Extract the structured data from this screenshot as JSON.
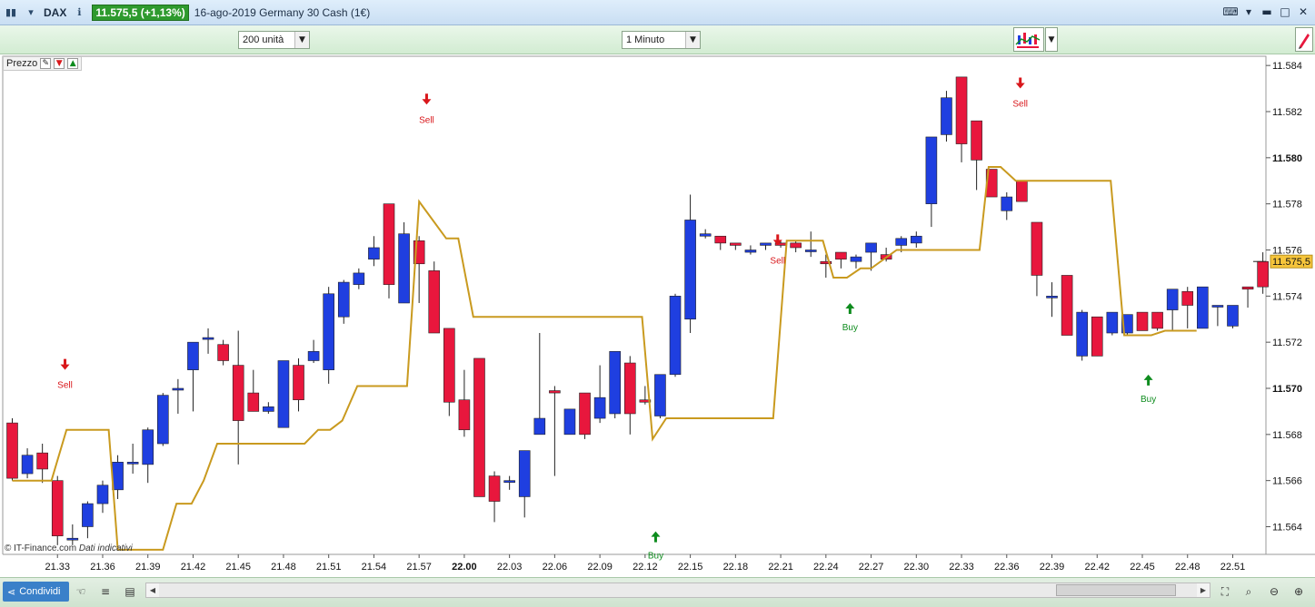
{
  "titlebar": {
    "ticker": "DAX",
    "price_badge": "11.575,5 (+1,13%)",
    "description": "16-ago-2019 Germany 30 Cash (1€)"
  },
  "toolbar": {
    "units_select": "200 unità",
    "interval_select": "1 Minuto"
  },
  "panel": {
    "label": "Prezzo"
  },
  "footer": {
    "copyright": "© IT-Finance.com",
    "note": "Dati indicativi"
  },
  "statusbar": {
    "share_label": "Condividi"
  },
  "colors": {
    "up": "#1f3fe0",
    "down": "#e8173d",
    "line": "#c99a1f",
    "sell": "#d9171b",
    "buy": "#0e8c1e",
    "last_price_bg": "#f6c53b"
  },
  "chart_data": {
    "type": "candlestick",
    "ylim": [
      11562.8,
      11584.4
    ],
    "y_ticks": [
      {
        "value": 11584,
        "label": "11.584"
      },
      {
        "value": 11582,
        "label": "11.582"
      },
      {
        "value": 11580,
        "label": "11.580",
        "bold": true
      },
      {
        "value": 11578,
        "label": "11.578"
      },
      {
        "value": 11576,
        "label": "11.576"
      },
      {
        "value": 11574,
        "label": "11.574"
      },
      {
        "value": 11572,
        "label": "11.572"
      },
      {
        "value": 11570,
        "label": "11.570",
        "bold": true
      },
      {
        "value": 11568,
        "label": "11.568"
      },
      {
        "value": 11566,
        "label": "11.566"
      },
      {
        "value": 11564,
        "label": "11.564"
      }
    ],
    "x_ticks": [
      {
        "index": 3,
        "label": "21.33"
      },
      {
        "index": 6,
        "label": "21.36"
      },
      {
        "index": 9,
        "label": "21.39"
      },
      {
        "index": 12,
        "label": "21.42"
      },
      {
        "index": 15,
        "label": "21.45"
      },
      {
        "index": 18,
        "label": "21.48"
      },
      {
        "index": 21,
        "label": "21.51"
      },
      {
        "index": 24,
        "label": "21.54"
      },
      {
        "index": 27,
        "label": "21.57"
      },
      {
        "index": 30,
        "label": "22.00",
        "bold": true
      },
      {
        "index": 33,
        "label": "22.03"
      },
      {
        "index": 36,
        "label": "22.06"
      },
      {
        "index": 39,
        "label": "22.09"
      },
      {
        "index": 42,
        "label": "22.12"
      },
      {
        "index": 45,
        "label": "22.15"
      },
      {
        "index": 48,
        "label": "22.18"
      },
      {
        "index": 51,
        "label": "22.21"
      },
      {
        "index": 54,
        "label": "22.24"
      },
      {
        "index": 57,
        "label": "22.27"
      },
      {
        "index": 60,
        "label": "22.30"
      },
      {
        "index": 63,
        "label": "22.33"
      },
      {
        "index": 66,
        "label": "22.36"
      },
      {
        "index": 69,
        "label": "22.39"
      },
      {
        "index": 72,
        "label": "22.42"
      },
      {
        "index": 75,
        "label": "22.45"
      },
      {
        "index": 78,
        "label": "22.48"
      },
      {
        "index": 81,
        "label": "22.51"
      }
    ],
    "last_price": {
      "value": 11575.5,
      "label": "11.575,5"
    },
    "candles": [
      [
        11568.5,
        11568.7,
        11566.0,
        11566.1
      ],
      [
        11566.3,
        11567.4,
        11566.1,
        11567.1
      ],
      [
        11567.2,
        11567.6,
        11565.9,
        11566.5
      ],
      [
        11566.0,
        11566.2,
        11563.2,
        11563.6
      ],
      [
        11563.5,
        11564.1,
        11563.2,
        11563.5
      ],
      [
        11564.0,
        11565.1,
        11563.5,
        11565.0
      ],
      [
        11565.0,
        11566.0,
        11564.6,
        11565.8
      ],
      [
        11565.6,
        11567.1,
        11565.2,
        11566.8
      ],
      [
        11566.8,
        11567.6,
        11566.3,
        11566.8
      ],
      [
        11566.7,
        11568.3,
        11565.9,
        11568.2
      ],
      [
        11567.6,
        11569.8,
        11567.5,
        11569.7
      ],
      [
        11570.0,
        11570.4,
        11568.9,
        11570.0
      ],
      [
        11570.8,
        11572.0,
        11569.0,
        11572.0
      ],
      [
        11572.2,
        11572.6,
        11571.5,
        11572.2
      ],
      [
        11571.9,
        11572.1,
        11571.0,
        11571.2
      ],
      [
        11571.0,
        11572.5,
        11566.7,
        11568.6
      ],
      [
        11569.8,
        11570.8,
        11569.0,
        11569.0
      ],
      [
        11569.0,
        11569.4,
        11568.9,
        11569.2
      ],
      [
        11568.3,
        11571.2,
        11568.3,
        11571.2
      ],
      [
        11571.0,
        11571.3,
        11569.0,
        11569.5
      ],
      [
        11571.2,
        11572.1,
        11571.1,
        11571.6
      ],
      [
        11570.8,
        11574.4,
        11570.2,
        11574.1
      ],
      [
        11573.1,
        11574.7,
        11572.8,
        11574.6
      ],
      [
        11574.5,
        11575.2,
        11574.3,
        11575.0
      ],
      [
        11575.6,
        11576.6,
        11575.3,
        11576.1
      ],
      [
        11578.0,
        11578.0,
        11573.9,
        11574.5
      ],
      [
        11573.7,
        11577.2,
        11573.7,
        11576.7
      ],
      [
        11576.4,
        11576.6,
        11573.7,
        11575.4
      ],
      [
        11575.1,
        11575.5,
        11572.4,
        11572.4
      ],
      [
        11572.6,
        11572.6,
        11568.8,
        11569.4
      ],
      [
        11569.5,
        11570.8,
        11567.9,
        11568.2
      ],
      [
        11571.3,
        11571.3,
        11565.3,
        11565.3
      ],
      [
        11566.2,
        11566.4,
        11564.2,
        11565.1
      ],
      [
        11566.0,
        11566.2,
        11565.6,
        11566.0
      ],
      [
        11565.3,
        11567.3,
        11564.4,
        11567.3
      ],
      [
        11568.0,
        11572.4,
        11568.0,
        11568.7
      ],
      [
        11569.9,
        11570.1,
        11566.2,
        11569.8
      ],
      [
        11568.0,
        11569.1,
        11568.0,
        11569.1
      ],
      [
        11569.8,
        11569.8,
        11567.8,
        11568.0
      ],
      [
        11568.7,
        11571.0,
        11568.5,
        11569.6
      ],
      [
        11568.9,
        11571.6,
        11568.7,
        11571.6
      ],
      [
        11571.1,
        11571.4,
        11568.0,
        11568.9
      ],
      [
        11569.5,
        11570.1,
        11569.3,
        11569.4
      ],
      [
        11568.8,
        11570.6,
        11568.7,
        11570.6
      ],
      [
        11570.6,
        11574.1,
        11570.5,
        11574.0
      ],
      [
        11573.0,
        11578.4,
        11572.4,
        11577.3
      ],
      [
        11576.6,
        11576.9,
        11576.5,
        11576.7
      ],
      [
        11576.6,
        11576.6,
        11576.0,
        11576.3
      ],
      [
        11576.3,
        11576.3,
        11576.0,
        11576.2
      ],
      [
        11575.9,
        11576.2,
        11575.8,
        11576.0
      ],
      [
        11576.2,
        11576.3,
        11576.0,
        11576.3
      ],
      [
        11576.3,
        11576.4,
        11576.1,
        11576.2
      ],
      [
        11576.3,
        11576.4,
        11575.9,
        11576.1
      ],
      [
        11576.0,
        11576.8,
        11575.7,
        11576.0
      ],
      [
        11575.5,
        11575.8,
        11574.8,
        11575.4
      ],
      [
        11575.9,
        11575.9,
        11575.2,
        11575.6
      ],
      [
        11575.5,
        11575.8,
        11575.2,
        11575.7
      ],
      [
        11575.9,
        11576.3,
        11575.1,
        11576.3
      ],
      [
        11575.8,
        11576.1,
        11575.5,
        11575.6
      ],
      [
        11576.2,
        11576.6,
        11575.9,
        11576.5
      ],
      [
        11576.3,
        11576.8,
        11576.1,
        11576.6
      ],
      [
        11578.0,
        11579.4,
        11577.0,
        11580.9
      ],
      [
        11581.0,
        11582.9,
        11580.7,
        11582.6
      ],
      [
        11583.5,
        11583.5,
        11579.8,
        11580.6
      ],
      [
        11581.6,
        11581.6,
        11578.6,
        11579.9
      ],
      [
        11579.5,
        11579.5,
        11578.4,
        11578.3
      ],
      [
        11577.7,
        11578.5,
        11577.3,
        11578.3
      ],
      [
        11579.0,
        11579.0,
        11578.1,
        11578.1
      ],
      [
        11577.2,
        11577.2,
        11574.0,
        11574.9
      ],
      [
        11574.0,
        11574.6,
        11573.1,
        11574.0
      ],
      [
        11574.9,
        11574.9,
        11572.3,
        11572.3
      ],
      [
        11571.4,
        11573.4,
        11571.2,
        11573.3
      ],
      [
        11573.1,
        11573.1,
        11571.4,
        11571.4
      ],
      [
        11572.4,
        11573.3,
        11572.3,
        11573.3
      ],
      [
        11572.4,
        11573.2,
        11572.3,
        11573.2
      ],
      [
        11573.3,
        11573.3,
        11572.5,
        11572.5
      ],
      [
        11573.3,
        11573.3,
        11572.5,
        11572.6
      ],
      [
        11573.4,
        11574.3,
        11572.5,
        11574.3
      ],
      [
        11574.2,
        11574.4,
        11572.6,
        11573.6
      ],
      [
        11572.6,
        11574.4,
        11572.6,
        11574.4
      ],
      [
        11573.6,
        11573.6,
        11572.7,
        11573.6
      ],
      [
        11572.7,
        11573.6,
        11572.6,
        11573.6
      ],
      [
        11574.4,
        11574.4,
        11573.5,
        11574.3
      ],
      [
        11575.5,
        11575.9,
        11574.1,
        11574.4
      ]
    ],
    "line": [
      [
        0,
        11566.0
      ],
      [
        2.6,
        11566.0
      ],
      [
        3.6,
        11568.2
      ],
      [
        6.4,
        11568.2
      ],
      [
        7.0,
        11563.0
      ],
      [
        10.0,
        11563.0
      ],
      [
        10.9,
        11565.0
      ],
      [
        11.9,
        11565.0
      ],
      [
        12.7,
        11566.0
      ],
      [
        13.6,
        11567.6
      ],
      [
        19.4,
        11567.6
      ],
      [
        20.3,
        11568.2
      ],
      [
        21.1,
        11568.2
      ],
      [
        21.9,
        11568.6
      ],
      [
        22.9,
        11570.1
      ],
      [
        26.2,
        11570.1
      ],
      [
        27.0,
        11578.1
      ],
      [
        28.8,
        11576.5
      ],
      [
        29.6,
        11576.5
      ],
      [
        30.6,
        11573.1
      ],
      [
        41.8,
        11573.1
      ],
      [
        42.5,
        11567.8
      ],
      [
        43.4,
        11568.7
      ],
      [
        50.5,
        11568.7
      ],
      [
        51.4,
        11576.4
      ],
      [
        53.8,
        11576.4
      ],
      [
        54.5,
        11574.8
      ],
      [
        55.4,
        11574.8
      ],
      [
        56.3,
        11575.2
      ],
      [
        57.0,
        11575.2
      ],
      [
        58.7,
        11576.0
      ],
      [
        64.2,
        11576.0
      ],
      [
        64.8,
        11579.6
      ],
      [
        65.6,
        11579.6
      ],
      [
        66.6,
        11579.0
      ],
      [
        72.9,
        11579.0
      ],
      [
        73.8,
        11572.3
      ],
      [
        75.6,
        11572.3
      ],
      [
        76.5,
        11572.5
      ],
      [
        78.6,
        11572.5
      ]
    ],
    "signals": [
      {
        "type": "Sell",
        "index": 3.5,
        "arrow_value": 11571.0,
        "label": "Sell"
      },
      {
        "type": "Sell",
        "index": 27.5,
        "arrow_value": 11582.5,
        "label": "Sell"
      },
      {
        "type": "Buy",
        "index": 42.7,
        "arrow_value": 11563.6,
        "label": "Buy"
      },
      {
        "type": "Sell",
        "index": 50.8,
        "arrow_value": 11576.4,
        "label": "Sell"
      },
      {
        "type": "Buy",
        "index": 55.6,
        "arrow_value": 11573.5,
        "label": "Buy"
      },
      {
        "type": "Sell",
        "index": 66.9,
        "arrow_value": 11583.2,
        "label": "Sell"
      },
      {
        "type": "Buy",
        "index": 75.4,
        "arrow_value": 11570.4,
        "label": "Buy"
      }
    ]
  }
}
